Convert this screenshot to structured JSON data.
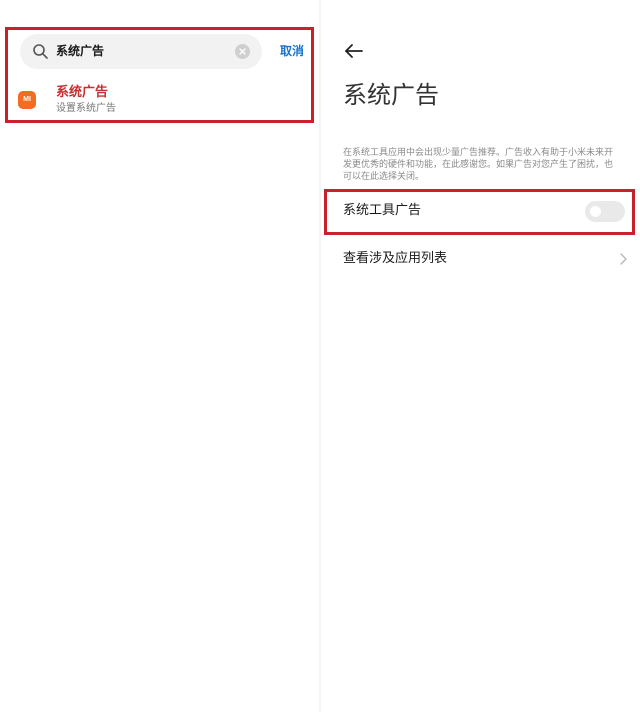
{
  "left": {
    "search": {
      "query": "系统广告",
      "cancel_label": "取消"
    },
    "result": {
      "app_icon_text": "MI",
      "title": "系统广告",
      "subtitle": "设置系统广告"
    }
  },
  "right": {
    "title": "系统广告",
    "description": "在系统工具应用中会出现少量广告推荐。广告收入有助于小米未来开发更优秀的硬件和功能，在此感谢您。如果广告对您产生了困扰，也可以在此选择关闭。",
    "toggle": {
      "label": "系统工具广告",
      "enabled": false
    },
    "list_item": {
      "label": "查看涉及应用列表"
    }
  },
  "colors": {
    "highlight": "#c8212b",
    "accent_link": "#1a73c8",
    "result_title": "#c63030",
    "app_icon_bg": "#f26d21"
  },
  "icons": [
    "search-icon",
    "clear-icon",
    "mi-app-icon",
    "back-arrow-icon",
    "chevron-right-icon"
  ]
}
